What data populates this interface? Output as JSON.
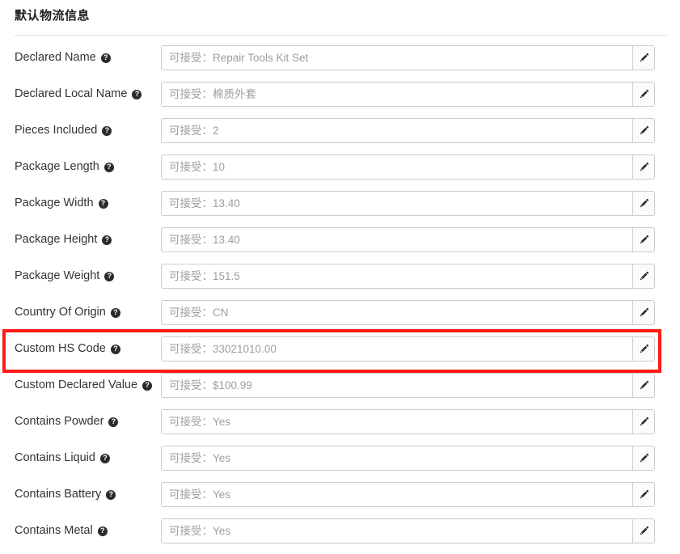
{
  "section": {
    "title": "默认物流信息"
  },
  "icons": {
    "help": "help-circle-icon",
    "edit": "pencil-edit-icon"
  },
  "colors": {
    "highlight": "#ff1a14",
    "label_text": "#333333",
    "placeholder_text": "#9e9e9e",
    "input_border": "#cccccc",
    "divider": "#e0e0e0"
  },
  "highlight": {
    "target_row": "Custom HS Code"
  },
  "help_glyph": "?",
  "rows": [
    {
      "label": "Declared Name",
      "placeholder": "可接受：Repair Tools Kit Set",
      "value": "",
      "edit_label": "编辑",
      "highlighted": false
    },
    {
      "label": "Declared Local Name",
      "placeholder": "可接受：棉质外套",
      "value": "",
      "edit_label": "编辑",
      "highlighted": false
    },
    {
      "label": "Pieces Included",
      "placeholder": "可接受：2",
      "value": "",
      "edit_label": "编辑",
      "highlighted": false
    },
    {
      "label": "Package Length",
      "placeholder": "可接受：10",
      "value": "",
      "edit_label": "编辑",
      "highlighted": false
    },
    {
      "label": "Package Width",
      "placeholder": "可接受：13.40",
      "value": "",
      "edit_label": "编辑",
      "highlighted": false
    },
    {
      "label": "Package Height",
      "placeholder": "可接受：13.40",
      "value": "",
      "edit_label": "编辑",
      "highlighted": false
    },
    {
      "label": "Package Weight",
      "placeholder": "可接受：151.5",
      "value": "",
      "edit_label": "编辑",
      "highlighted": false
    },
    {
      "label": "Country Of Origin",
      "placeholder": "可接受：CN",
      "value": "",
      "edit_label": "编辑",
      "highlighted": false
    },
    {
      "label": "Custom HS Code",
      "placeholder": "可接受：33021010.00",
      "value": "",
      "edit_label": "编辑",
      "highlighted": true
    },
    {
      "label": "Custom Declared Value",
      "placeholder": "可接受：$100.99",
      "value": "",
      "edit_label": "编辑",
      "highlighted": false
    },
    {
      "label": "Contains Powder",
      "placeholder": "可接受：Yes",
      "value": "",
      "edit_label": "编辑",
      "highlighted": false
    },
    {
      "label": "Contains Liquid",
      "placeholder": "可接受：Yes",
      "value": "",
      "edit_label": "编辑",
      "highlighted": false
    },
    {
      "label": "Contains Battery",
      "placeholder": "可接受：Yes",
      "value": "",
      "edit_label": "编辑",
      "highlighted": false
    },
    {
      "label": "Contains Metal",
      "placeholder": "可接受：Yes",
      "value": "",
      "edit_label": "编辑",
      "highlighted": false
    }
  ]
}
